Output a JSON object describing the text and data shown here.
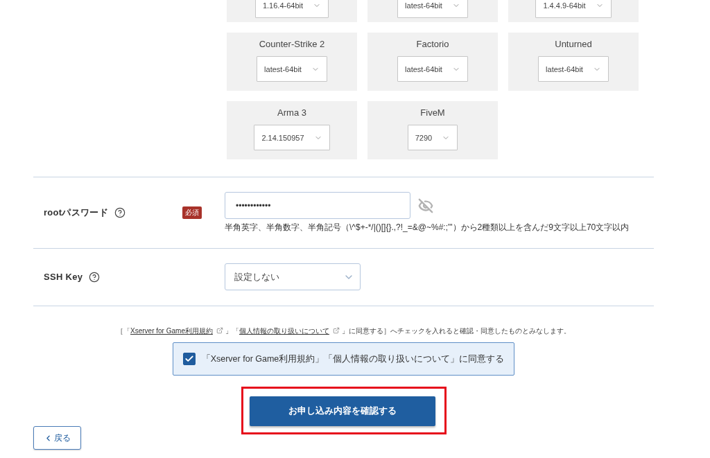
{
  "game_versions": [
    {
      "version": "1.16.4-64bit"
    },
    {
      "version": "latest-64bit"
    },
    {
      "version": "1.4.4.9-64bit"
    },
    {
      "title": "Counter-Strike 2",
      "version": "latest-64bit"
    },
    {
      "title": "Factorio",
      "version": "latest-64bit"
    },
    {
      "title": "Unturned",
      "version": "latest-64bit"
    },
    {
      "title": "Arma 3",
      "version": "2.14.150957"
    },
    {
      "title": "FiveM",
      "version": "7290"
    }
  ],
  "fields": [
    {
      "kind": "password",
      "label": "rootパスワード",
      "help": true,
      "required_badge": "必須",
      "value": "••••••••••••",
      "masked": true,
      "hint": "半角英字、半角数字、半角記号（\\^$+-*/|()[]{}.,?!_=&@~%#:;'\"）から2種類以上を含んだ9文字以上70文字以内"
    },
    {
      "kind": "select",
      "label": "SSH Key",
      "help": true,
      "value": "設定しない"
    }
  ],
  "consent": {
    "notice": [
      {
        "kind": "text",
        "text": "［「"
      },
      {
        "kind": "link",
        "text": "Xserver for Game利用規約"
      },
      {
        "kind": "text",
        "text": "」「"
      },
      {
        "kind": "link",
        "text": "個人情報の取り扱いについて"
      },
      {
        "kind": "text",
        "text": "」に同意する］へチェックを入れると確認・同意したものとみなします。"
      }
    ],
    "checkbox": {
      "label": "「Xserver for Game利用規約」「個人情報の取り扱いについて」に同意する",
      "checked": true
    }
  },
  "submit_button": {
    "label": "お申し込み内容を確認する",
    "highlighted": true
  },
  "back_button": {
    "label": "戻る"
  }
}
